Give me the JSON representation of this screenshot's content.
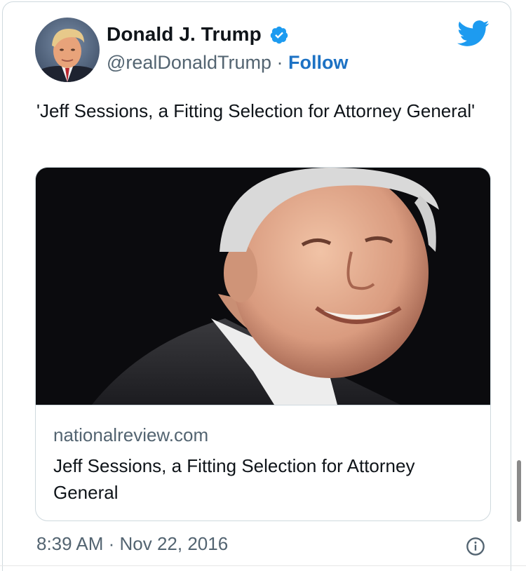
{
  "tweet": {
    "author_name": "Donald J. Trump",
    "handle": "@realDonaldTrump",
    "separator": "·",
    "follow_label": "Follow",
    "text": "'Jeff Sessions, a Fitting Selection for Attorney General'",
    "timestamp": "8:39 AM · Nov 22, 2016"
  },
  "link_card": {
    "domain": "nationalreview.com",
    "title": "Jeff Sessions, a Fitting Selection for Attorney General"
  },
  "colors": {
    "accent": "#1d9bf0",
    "follow": "#1d72c4",
    "text": "#0f1419",
    "secondary_text": "#536471",
    "border": "#cfd9de"
  },
  "icons": {
    "verified": "verified-badge-icon",
    "brand": "twitter-bird-icon",
    "info": "info-icon"
  }
}
